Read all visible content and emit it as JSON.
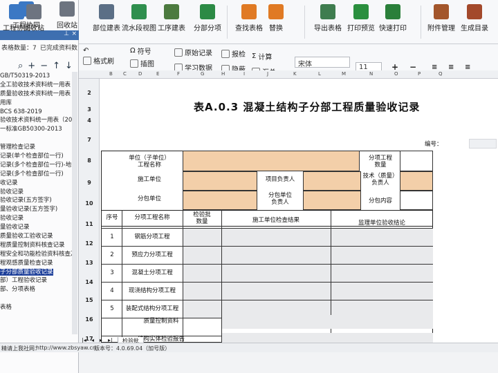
{
  "ribbon": {
    "items": [
      {
        "label": "工程协同",
        "icon": "people-icon",
        "color": "#3b78c4"
      },
      {
        "label": "回收站",
        "icon": "recycle-icon",
        "color": "#6d7480"
      },
      {
        "label": "部位建表",
        "icon": "table-icon",
        "color": "#5b6f86"
      },
      {
        "label": "流水段视图",
        "icon": "list-icon",
        "color": "#2f8f4e"
      },
      {
        "label": "工序建表",
        "icon": "grid-icon",
        "color": "#4c7a3f"
      },
      {
        "label": "分部分项",
        "icon": "chart-icon",
        "color": "#2c8a45"
      },
      {
        "label": "查找表格",
        "icon": "search-icon",
        "color": "#e07a24"
      },
      {
        "label": "替换",
        "icon": "replace-icon",
        "color": "#e07a24"
      },
      {
        "label": "导出表格",
        "icon": "export-icon",
        "color": "#3f7d4f"
      },
      {
        "label": "打印预览",
        "icon": "eye-icon",
        "color": "#2a8f3e"
      },
      {
        "label": "快速打印",
        "icon": "printer-icon",
        "color": "#2a7f3a"
      },
      {
        "label": "附件管理",
        "icon": "paperclip-icon",
        "color": "#a3562b"
      },
      {
        "label": "生成目录",
        "icon": "catalog-icon",
        "color": "#a3492b"
      }
    ]
  },
  "toolbar2": {
    "format_brush": "格式刷",
    "symbol": "符号",
    "illustration": "插图",
    "original_record": "原始记录",
    "learning_data": "学习数据",
    "reference": "报检",
    "hide": "隐蔽",
    "calculate": "计算",
    "summary": "汇总",
    "font_name": "宋体",
    "font_size": "11",
    "plus": "+",
    "minus": "−",
    "wrap": "行",
    "border": "边"
  },
  "left_panel": {
    "status_left": "表格数量：7",
    "status_right": "已完成资料数",
    "items": [
      "GB/T50319-2013",
      "全工验收技术资料统一用表（",
      "质量验收技术资料统一用表（",
      "用库",
      "BCS 638-2019",
      "验收技术资料统一用表（202",
      "一标准GB50300-2013",
      "",
      "管理检查记录",
      "记录(单个检查部位一行)",
      "记录(多个检查部位一行)-地",
      "记录(多个检查部位一行)",
      "收记录",
      "验收记录",
      "验收记录(五方签字)",
      "量验收记录(五方签字)",
      "验收记录",
      "量验收记录",
      "质量验收工验收记录",
      "程质量控制资料核查记录",
      "程安全和功能检验资料核查及",
      "程观感质量检查记录",
      "子分部质量验收记录",
      "部）工程验收记录",
      "部、分项表格",
      "",
      "表格"
    ],
    "selected_index": 22
  },
  "status_bar": {
    "text1": "精请上我社网：",
    "url": "http://www.zbsyaw.cn",
    "version": "版本号：4.0.69.04（加号版）"
  },
  "sheet": {
    "columns": [
      "B",
      "C",
      "D",
      "E",
      "F",
      "G",
      "H",
      "I",
      "J",
      "K",
      "L",
      "M",
      "N",
      "O",
      "P",
      "Q"
    ],
    "rows": [
      "2",
      "3",
      "4",
      "7",
      "8",
      "9",
      "10",
      "11",
      "12",
      "13",
      "14",
      "15",
      "16",
      "17",
      "18"
    ],
    "title": "表A.0.3  混凝土结构子分部工程质量验收记录",
    "serial_label": "编号：",
    "unit_label": "单位（子单位）\n工程名称",
    "sub_count_label": "分项工程\n数量",
    "construction_unit": "施工单位",
    "project_leader": "项目负责人",
    "tech_leader": "技术（质量）\n负责人",
    "subcontract_unit": "分包单位",
    "subcontract_leader": "分包单位\n负责人",
    "subcontract_content": "分包内容",
    "header_no": "序号",
    "header_item": "分项工程名称",
    "header_batch": "检验批\n数量",
    "header_check": "施工单位检查结果",
    "header_supervise": "监理单位验收结论",
    "rows_data": [
      {
        "no": "1",
        "name": "钢筋分项工程"
      },
      {
        "no": "2",
        "name": "预应力分项工程"
      },
      {
        "no": "3",
        "name": "混凝土分项工程"
      },
      {
        "no": "4",
        "name": "现浇结构分项工程"
      },
      {
        "no": "5",
        "name": "装配式结构分项工程"
      }
    ],
    "quality_control": "质量控制资料",
    "structure_check": "结构实体检验报告",
    "tab_label": "检验批"
  }
}
